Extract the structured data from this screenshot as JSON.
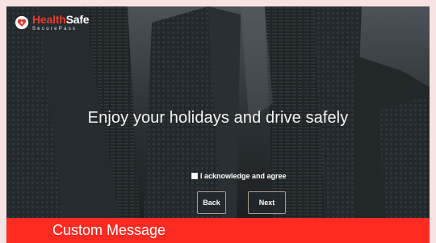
{
  "brand": {
    "name_red": "Health",
    "name_white": "Safe",
    "tagline": "SecurePass"
  },
  "screen": {
    "message": "Enjoy your holidays and drive safely",
    "acknowledge_label": "I acknowledge and agree",
    "acknowledge_checked": false,
    "back_label": "Back",
    "next_label": "Next"
  },
  "caption": {
    "text": "Custom Message"
  },
  "colors": {
    "accent_red": "#ff2a22",
    "brand_red": "#e53a2c"
  },
  "icons": {
    "logo": "shield-heart-icon"
  }
}
